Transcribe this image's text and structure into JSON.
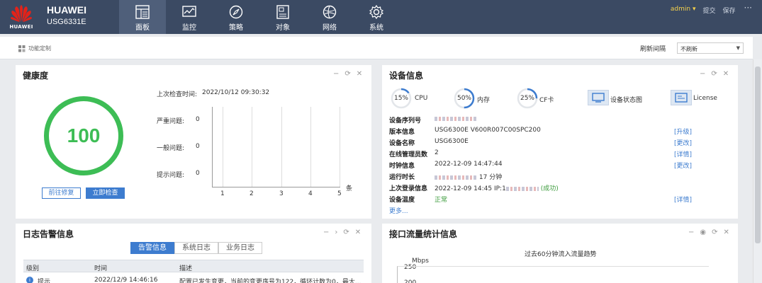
{
  "header": {
    "brand": "HUAWEI",
    "logo_text": "HUAWEI",
    "model": "USG6331E",
    "nav": [
      {
        "label": "面板",
        "icon": "dashboard-icon",
        "active": true
      },
      {
        "label": "监控",
        "icon": "monitor-icon",
        "active": false
      },
      {
        "label": "策略",
        "icon": "policy-icon",
        "active": false
      },
      {
        "label": "对象",
        "icon": "object-icon",
        "active": false
      },
      {
        "label": "网络",
        "icon": "network-icon",
        "active": false
      },
      {
        "label": "系统",
        "icon": "gear-icon",
        "active": false
      }
    ],
    "user": "admin",
    "submit": "提交",
    "save": "保存",
    "more": "···"
  },
  "toolbar": {
    "customize": "功能定制",
    "refresh_label": "刷新间隔",
    "refresh_value": "不刷新"
  },
  "health": {
    "title": "健康度",
    "score": "100",
    "score_fraction": 1.0,
    "last_check_label": "上次检查时间:",
    "last_check_time": "2022/10/12 09:30:32",
    "fix_button": "前往修复",
    "check_button": "立即检查",
    "rows": [
      {
        "label": "严重问题:",
        "value": "0"
      },
      {
        "label": "一般问题:",
        "value": "0"
      },
      {
        "label": "提示问题:",
        "value": "0"
      }
    ],
    "x_ticks": [
      "1",
      "2",
      "3",
      "4",
      "5"
    ],
    "x_unit": "条"
  },
  "device": {
    "title": "设备信息",
    "cpu": {
      "value": "15%",
      "label": "CPU",
      "fraction": 0.15
    },
    "mem": {
      "value": "50%",
      "label": "内存",
      "fraction": 0.5
    },
    "cf": {
      "value": "25%",
      "label": "CF卡",
      "fraction": 0.25
    },
    "status_chart": "设备状态图",
    "license": "License",
    "rows": [
      {
        "label": "设备序列号",
        "value": "",
        "masked": true,
        "link": ""
      },
      {
        "label": "版本信息",
        "value": "USG6300E V600R007C00SPC200",
        "link": "[升级]"
      },
      {
        "label": "设备名称",
        "value": "USG6300E",
        "link": "[更改]"
      },
      {
        "label": "在线管理员数",
        "value": "2",
        "link": "[详情]"
      },
      {
        "label": "时钟信息",
        "value": "2022-12-09 14:47:44",
        "link": "[更改]"
      },
      {
        "label": "运行时长",
        "value": "17 分钟",
        "masked": true,
        "link": ""
      },
      {
        "label": "上次登录信息",
        "value": "2022-12-09 14:45 IP:1",
        "suffix": "(成功)",
        "masked": true,
        "link": ""
      },
      {
        "label": "设备温度",
        "value": "正常",
        "link": "[详情]"
      }
    ],
    "more": "更多..."
  },
  "logs": {
    "title": "日志告警信息",
    "tabs": [
      "告警信息",
      "系统日志",
      "业务日志"
    ],
    "columns": [
      "级别",
      "时间",
      "描述"
    ],
    "rows": [
      {
        "level": "提示",
        "time": "2022/12/9 14:46:16",
        "desc": "配置已发生变更，当前的变更序号为122，循环计数为0，最大..."
      }
    ]
  },
  "traffic": {
    "title": "接口流量统计信息",
    "chart_title": "过去60分钟流入流量趋势",
    "unit": "Mbps",
    "y_ticks": [
      "250",
      "200"
    ]
  }
}
